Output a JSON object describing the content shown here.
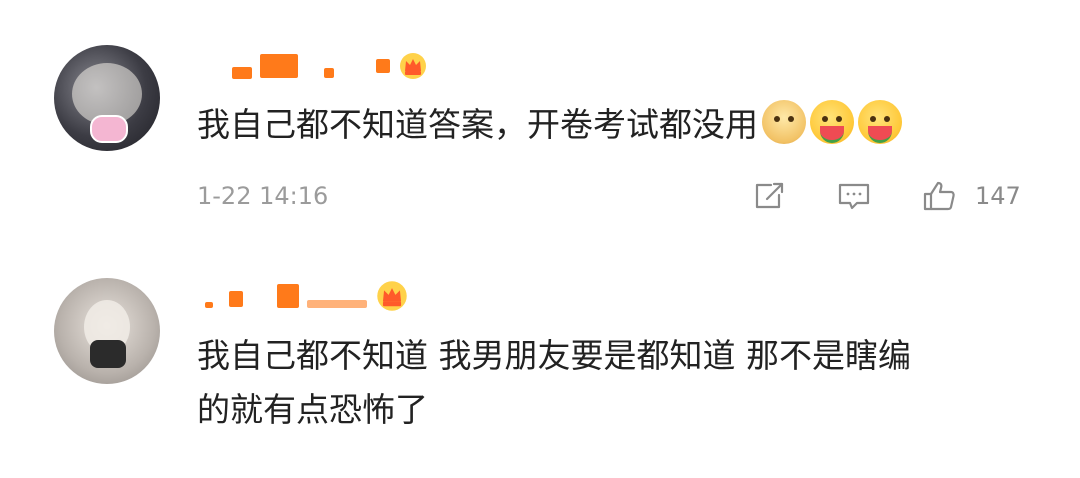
{
  "comments": [
    {
      "text": "我自己都不知道答案，开卷考试都没用",
      "emojis": [
        "doge-icon",
        "watermelon-eating-icon",
        "watermelon-eating-icon"
      ],
      "timestamp": "1-22 14:16",
      "like_count": "147"
    },
    {
      "text_line1": "我自己都不知道 我男朋友要是都知道 那不是瞎编",
      "text_line2": "的就有点恐怖了"
    }
  ],
  "icons": {
    "share": "share-icon",
    "comment": "comment-icon",
    "like": "like-icon",
    "member_badge": "crown-icon"
  },
  "colors": {
    "username": "#ff8200",
    "body_text": "#222222",
    "meta_text": "#9b9b9b"
  }
}
